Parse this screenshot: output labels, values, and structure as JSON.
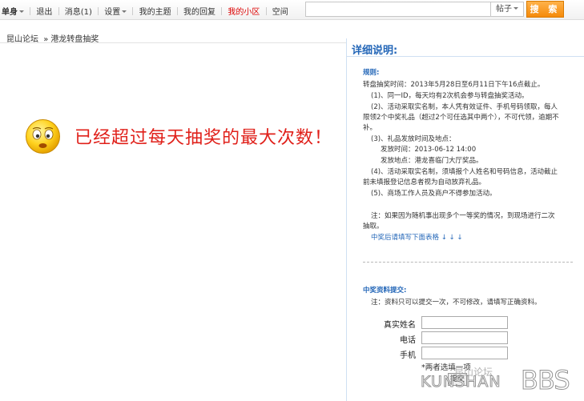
{
  "nav": {
    "items": [
      "单身",
      "退出",
      "消息(1)",
      "设置",
      "我的主题",
      "我的回复",
      "我的小区",
      "空间"
    ]
  },
  "search": {
    "type_label": "帖子",
    "button_label": "搜 索"
  },
  "breadcrumb": {
    "home": "昆山论坛",
    "sep": "»",
    "current": "港龙转盘抽奖"
  },
  "message": "已经超过每天抽奖的最大次数！",
  "panel": {
    "title": "详细说明:",
    "rules_heading": "规则:",
    "rules": [
      "转盘抽奖时间：2013年5月28日至6月11日下午16点截止。",
      "(1)、同一ID，每天均有2次机会参与转盘抽奖活动。",
      "(2)、活动采取实名制，本人凭有效证件、手机号码领取，每人",
      "限领2个中奖礼品（超过2个可任选其中两个），不可代领，逾期不",
      "补。",
      "(3)、礼品发放时间及地点：",
      "发放时间：2013-06-12 14:00",
      "发放地点：港龙喜临门大厅奖品。",
      "(4)、活动采取实名制，须填报个人姓名和号码信息，活动截止",
      "前未填报登记信息者视为自动放弃礼品。",
      "(5)、商场工作人员及商户不得参加活动。"
    ],
    "note_line1": "注：如果因为随机事出现多个一等奖的情况，到现场进行二次",
    "note_line2": "抽取。",
    "fill_hint": "中奖后请填写下面表格 ↓ ↓ ↓",
    "submit_heading": "中奖资料提交:",
    "submit_note": "注：资料只可以提交一次，不可修改，请填写正确资料。",
    "form": {
      "name_label": "真实姓名",
      "phone_label": "电话",
      "mobile_label": "手机",
      "either_note": "*两者选填一项",
      "submit_label": "提交"
    }
  },
  "watermark": {
    "cn": "昆山论坛",
    "en": "KUNSHAN",
    "bbs": "BBS"
  }
}
